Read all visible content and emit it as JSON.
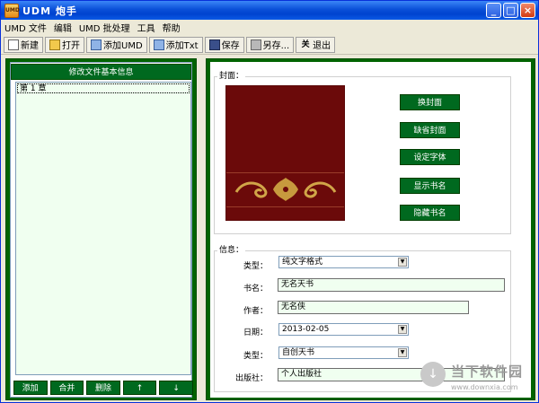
{
  "window": {
    "title": "UDM 炮手",
    "app_icon_text": "UMD",
    "minimize_glyph": "_",
    "maximize_glyph": "□",
    "close_glyph": "×"
  },
  "menu": [
    "UMD 文件",
    "编辑",
    "UMD 批处理",
    "工具",
    "帮助"
  ],
  "toolbar": {
    "new": "新建",
    "open": "打开",
    "add_umd": "添加UMD",
    "add_txt": "添加Txt",
    "save": "保存",
    "save_as": "另存...",
    "exit": "退出",
    "exit_icon_glyph": "关"
  },
  "left_panel": {
    "header": "修改文件基本信息",
    "chapters": [
      "第 1 章"
    ],
    "buttons": [
      "添加",
      "合并",
      "删除",
      "↑",
      "↓"
    ]
  },
  "cover_section": {
    "title": "封面：",
    "buttons": [
      "换封面",
      "缺省封面",
      "设定字体",
      "显示书名",
      "隐藏书名"
    ]
  },
  "info_section": {
    "title": "信息：",
    "type_label": "类型：",
    "type_value": "纯文字格式",
    "bookname_label": "书名：",
    "bookname_value": "无名天书",
    "author_label": "作者：",
    "author_value": "无名侠",
    "date_label": "日期：",
    "date_value": "2013-02-05",
    "category_label": "类型：",
    "category_value": "自创天书",
    "publisher_label": "出版社：",
    "publisher_value": "个人出版社",
    "dropdown_arrow_glyph": "▼"
  },
  "watermark": {
    "logo_glyph": "↓",
    "text": "当下软件园",
    "sub": "www.downxia.com"
  },
  "colors": {
    "panel_green": "#006400",
    "button_green": "#00691f",
    "cover_red": "#6b0a0a",
    "input_bg": "#f0fff0"
  }
}
